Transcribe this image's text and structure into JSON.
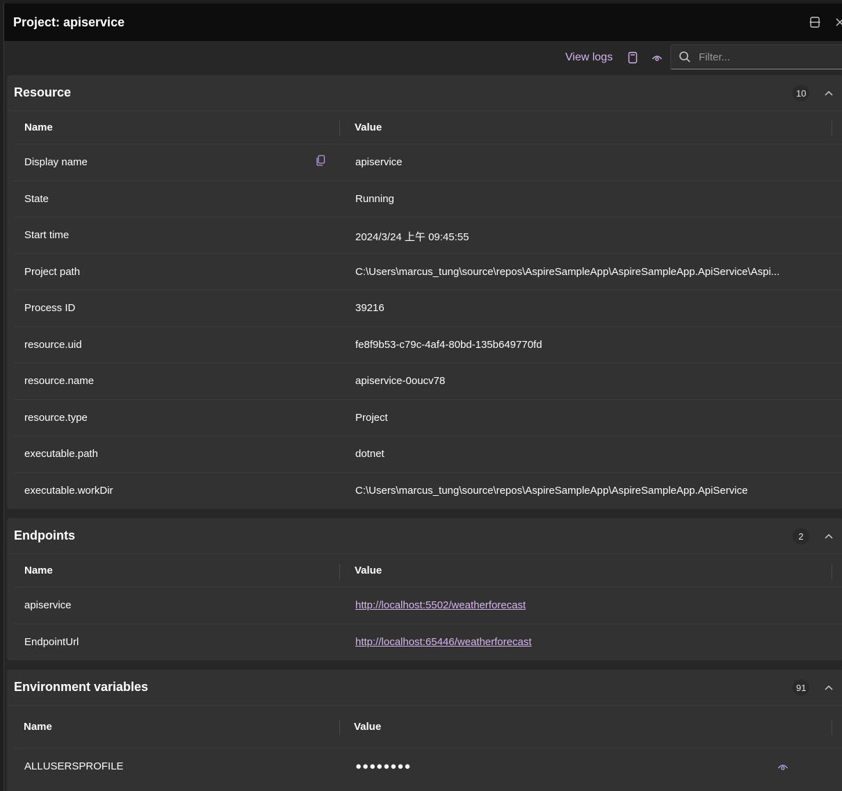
{
  "titlebar": {
    "title": "Project: apiservice"
  },
  "toolbar": {
    "view_logs_label": "View logs",
    "filter_placeholder": "Filter..."
  },
  "resource": {
    "title": "Resource",
    "count": "10",
    "columns": {
      "name": "Name",
      "value": "Value"
    },
    "rows": [
      {
        "name": "Display name",
        "value": "apiservice"
      },
      {
        "name": "State",
        "value": "Running"
      },
      {
        "name": "Start time",
        "value": "2024/3/24 上午 09:45:55"
      },
      {
        "name": "Project path",
        "value": "C:\\Users\\marcus_tung\\source\\repos\\AspireSampleApp\\AspireSampleApp.ApiService\\Aspi..."
      },
      {
        "name": "Process ID",
        "value": "39216"
      },
      {
        "name": "resource.uid",
        "value": "fe8f9b53-c79c-4af4-80bd-135b649770fd"
      },
      {
        "name": "resource.name",
        "value": "apiservice-0oucv78"
      },
      {
        "name": "resource.type",
        "value": "Project"
      },
      {
        "name": "executable.path",
        "value": "dotnet"
      },
      {
        "name": "executable.workDir",
        "value": "C:\\Users\\marcus_tung\\source\\repos\\AspireSampleApp\\AspireSampleApp.ApiService"
      }
    ]
  },
  "endpoints": {
    "title": "Endpoints",
    "count": "2",
    "columns": {
      "name": "Name",
      "value": "Value"
    },
    "rows": [
      {
        "name": "apiservice",
        "value": "http://localhost:5502/weatherforecast"
      },
      {
        "name": "EndpointUrl",
        "value": "http://localhost:65446/weatherforecast"
      }
    ]
  },
  "environment": {
    "title": "Environment variables",
    "count": "91",
    "columns": {
      "name": "Name",
      "value": "Value"
    },
    "rows": [
      {
        "name": "ALLUSERSPROFILE",
        "value": "●●●●●●●●"
      }
    ]
  },
  "icons": {
    "split": "split-view-icon",
    "close": "close-icon",
    "logs": "document-icon",
    "visibility": "eye-icon",
    "search": "search-icon",
    "collapse": "chevron-up-icon",
    "copy": "copy-icon"
  },
  "colors": {
    "accent": "#d7b5f0",
    "panel": "#323232",
    "background": "#272727",
    "titlebar": "#0d0d0d"
  }
}
